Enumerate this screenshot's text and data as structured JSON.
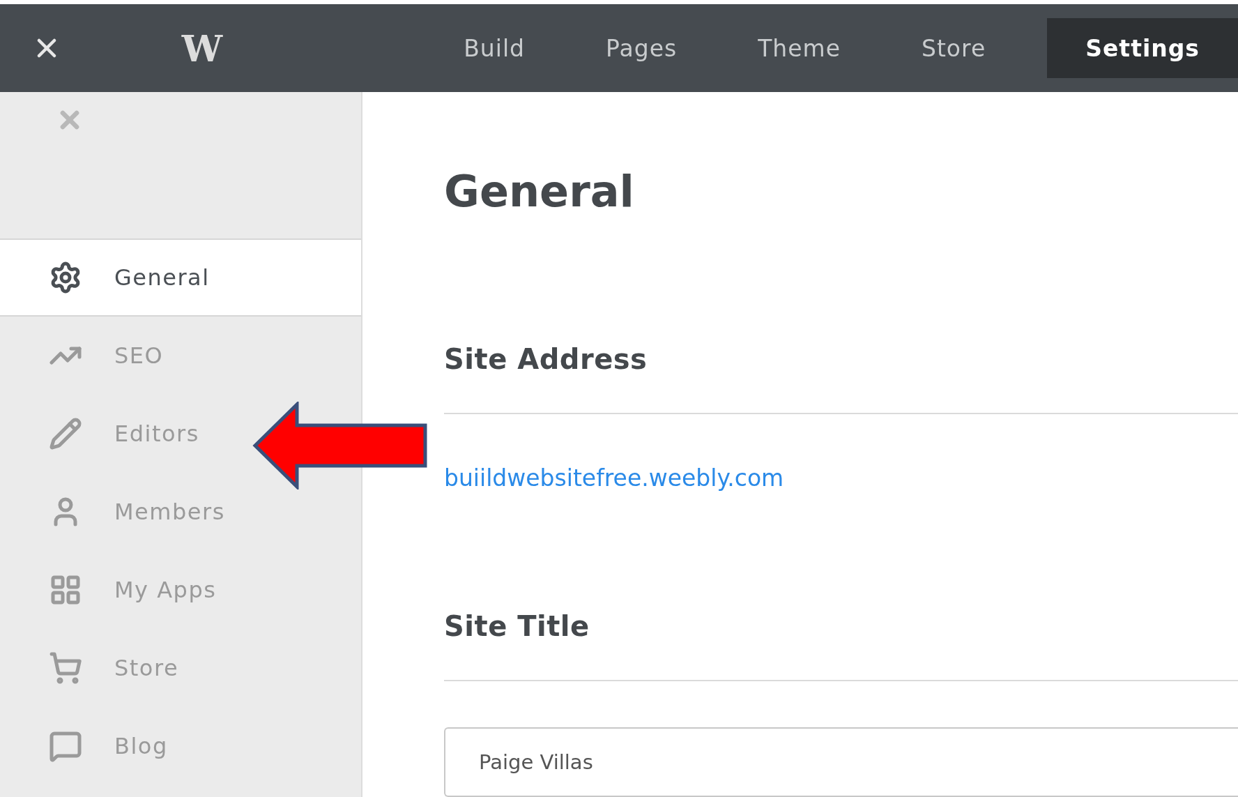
{
  "top_bar": {
    "logo": "W",
    "tabs": [
      {
        "label": "Build",
        "selected": false
      },
      {
        "label": "Pages",
        "selected": false
      },
      {
        "label": "Theme",
        "selected": false
      },
      {
        "label": "Store",
        "selected": false
      },
      {
        "label": "Settings",
        "selected": true
      }
    ]
  },
  "sidebar": {
    "items": [
      {
        "label": "General",
        "selected": true
      },
      {
        "label": "SEO",
        "selected": false
      },
      {
        "label": "Editors",
        "selected": false
      },
      {
        "label": "Members",
        "selected": false
      },
      {
        "label": "My Apps",
        "selected": false
      },
      {
        "label": "Store",
        "selected": false
      },
      {
        "label": "Blog",
        "selected": false
      }
    ]
  },
  "content": {
    "title": "General",
    "sections": [
      {
        "heading": "Site Address",
        "kind": "link",
        "value": "buiildwebsitefree.weebly.com"
      },
      {
        "heading": "Site Title",
        "kind": "input",
        "value": "Paige Villas"
      }
    ]
  }
}
